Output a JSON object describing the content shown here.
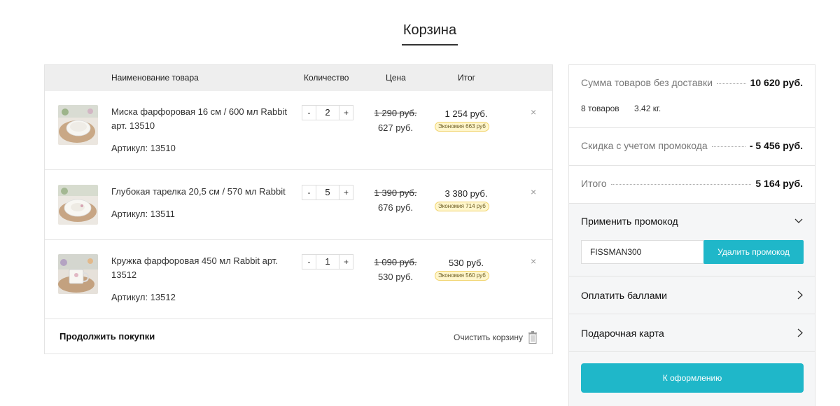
{
  "page": {
    "title": "Корзина"
  },
  "cart": {
    "columns": {
      "name": "Наименование товара",
      "qty": "Количество",
      "price": "Цена",
      "total": "Итог"
    },
    "items": [
      {
        "name": "Миска фарфоровая 16 см / 600 мл Rabbit арт. 13510",
        "sku": "Артикул: 13510",
        "qty": "2",
        "old_price": "1 290 руб.",
        "price": "627 руб.",
        "total": "1 254 руб.",
        "saving": "Экономия 663 руб"
      },
      {
        "name": "Глубокая тарелка 20,5 см / 570 мл Rabbit",
        "sku": "Артикул: 13511",
        "qty": "5",
        "old_price": "1 390 руб.",
        "price": "676 руб.",
        "total": "3 380 руб.",
        "saving": "Экономия 714 руб"
      },
      {
        "name": "Кружка фарфоровая 450 мл Rabbit арт. 13512",
        "sku": "Артикул: 13512",
        "qty": "1",
        "old_price": "1 090 руб.",
        "price": "530 руб.",
        "total": "530 руб.",
        "saving": "Экономия 560 руб"
      }
    ],
    "controls": {
      "minus": "-",
      "plus": "+",
      "remove": "×"
    },
    "footer": {
      "continue": "Продолжить покупки",
      "clear": "Очистить корзину"
    }
  },
  "summary": {
    "subtotal_label": "Сумма товаров без доставки",
    "subtotal_value": "10 620 руб.",
    "count": "8 товаров",
    "weight": "3.42 кг.",
    "discount_label": "Скидка с учетом промокода",
    "discount_value": "- 5 456 руб.",
    "total_label": "Итого",
    "total_value": "5 164 руб.",
    "promo": {
      "title": "Применить промокод",
      "value": "FISSMAN300",
      "remove_button": "Удалить промокод"
    },
    "points": "Оплатить баллами",
    "gift_card": "Подарочная карта",
    "checkout": "К оформлению"
  },
  "colors": {
    "accent": "#1fb7c9",
    "saving_bg": "#fff6cc",
    "header_bg": "#eeeeee"
  }
}
